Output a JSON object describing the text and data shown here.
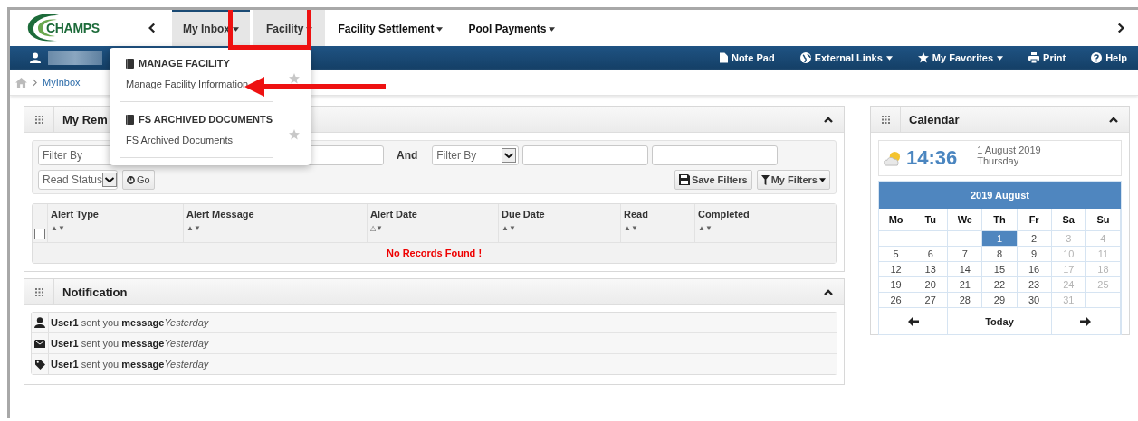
{
  "logo": {
    "text": "CHAMPS"
  },
  "nav": {
    "tabs": [
      {
        "label": "My Inbox",
        "selected": true,
        "expanded": false
      },
      {
        "label": "Facility",
        "selected": false,
        "expanded": true
      },
      {
        "label": "Facility Settlement",
        "selected": false,
        "expanded": false
      },
      {
        "label": "Pool Payments",
        "selected": false,
        "expanded": false
      }
    ]
  },
  "toolbar": {
    "links": [
      {
        "kind": "notepad",
        "label": "Note Pad",
        "caret": false
      },
      {
        "kind": "globe",
        "label": "External Links",
        "caret": true
      },
      {
        "kind": "star",
        "label": "My Favorites",
        "caret": true
      },
      {
        "kind": "print",
        "label": "Print",
        "caret": false
      },
      {
        "kind": "help",
        "label": "Help",
        "caret": false
      }
    ]
  },
  "breadcrumb": {
    "items": [
      "MyInbox"
    ]
  },
  "facility_menu": {
    "sections": [
      {
        "heading": "MANAGE FACILITY",
        "items": [
          {
            "label": "Manage Facility Information",
            "favorite": false
          }
        ]
      },
      {
        "heading": "FS ARCHIVED DOCUMENTS",
        "items": [
          {
            "label": "FS Archived Documents",
            "favorite": false
          }
        ]
      }
    ]
  },
  "reminders_panel": {
    "title": "My Rem",
    "filters": {
      "first_select": "Filter By",
      "and_label": "And",
      "second_select": "Filter By",
      "read_status": "Read Status",
      "go": "Go",
      "save_filters": "Save Filters",
      "my_filters": "My Filters"
    },
    "table": {
      "columns": [
        {
          "label": "Alert Type",
          "sort": "▲▼"
        },
        {
          "label": "Alert Message",
          "sort": "▲▼"
        },
        {
          "label": "Alert Date",
          "sort": "△▼"
        },
        {
          "label": "Due Date",
          "sort": "▲▼"
        },
        {
          "label": "Read",
          "sort": "▲▼"
        },
        {
          "label": "Completed",
          "sort": "▲▼"
        }
      ],
      "select_all_checked": false,
      "empty_message": "No Records Found !"
    }
  },
  "notification_panel": {
    "title": "Notification",
    "items": [
      {
        "kind": "user",
        "user": "User1",
        "text": "sent you",
        "subject": "message",
        "time": "Yesterday"
      },
      {
        "kind": "envelope",
        "user": "User1",
        "text": "sent you",
        "subject": "message",
        "time": "Yesterday"
      },
      {
        "kind": "tag",
        "user": "User1",
        "text": "sent you",
        "subject": "message",
        "time": "Yesterday"
      }
    ]
  },
  "calendar_panel": {
    "title": "Calendar",
    "time": "14:36",
    "date": "1 August 2019",
    "weekday": "Thursday",
    "month_title": "2019 August",
    "day_names": [
      "Mo",
      "Tu",
      "We",
      "Th",
      "Fr",
      "Sa",
      "Su"
    ],
    "weeks": [
      [
        {
          "kind": "blank"
        },
        {
          "kind": "blank"
        },
        {
          "kind": "blank"
        },
        {
          "kind": "day",
          "label": "1",
          "selected": true,
          "muted": false
        },
        {
          "kind": "day",
          "label": "2",
          "selected": false,
          "muted": false
        },
        {
          "kind": "day",
          "label": "3",
          "selected": false,
          "muted": true
        },
        {
          "kind": "day",
          "label": "4",
          "selected": false,
          "muted": true
        }
      ],
      [
        {
          "kind": "day",
          "label": "5",
          "selected": false,
          "muted": false
        },
        {
          "kind": "day",
          "label": "6",
          "selected": false,
          "muted": false
        },
        {
          "kind": "day",
          "label": "7",
          "selected": false,
          "muted": false
        },
        {
          "kind": "day",
          "label": "8",
          "selected": false,
          "muted": false
        },
        {
          "kind": "day",
          "label": "9",
          "selected": false,
          "muted": false
        },
        {
          "kind": "day",
          "label": "10",
          "selected": false,
          "muted": true
        },
        {
          "kind": "day",
          "label": "11",
          "selected": false,
          "muted": true
        }
      ],
      [
        {
          "kind": "day",
          "label": "12",
          "selected": false,
          "muted": false
        },
        {
          "kind": "day",
          "label": "13",
          "selected": false,
          "muted": false
        },
        {
          "kind": "day",
          "label": "14",
          "selected": false,
          "muted": false
        },
        {
          "kind": "day",
          "label": "15",
          "selected": false,
          "muted": false
        },
        {
          "kind": "day",
          "label": "16",
          "selected": false,
          "muted": false
        },
        {
          "kind": "day",
          "label": "17",
          "selected": false,
          "muted": true
        },
        {
          "kind": "day",
          "label": "18",
          "selected": false,
          "muted": true
        }
      ],
      [
        {
          "kind": "day",
          "label": "19",
          "selected": false,
          "muted": false
        },
        {
          "kind": "day",
          "label": "20",
          "selected": false,
          "muted": false
        },
        {
          "kind": "day",
          "label": "21",
          "selected": false,
          "muted": false
        },
        {
          "kind": "day",
          "label": "22",
          "selected": false,
          "muted": false
        },
        {
          "kind": "day",
          "label": "23",
          "selected": false,
          "muted": false
        },
        {
          "kind": "day",
          "label": "24",
          "selected": false,
          "muted": true
        },
        {
          "kind": "day",
          "label": "25",
          "selected": false,
          "muted": true
        }
      ],
      [
        {
          "kind": "day",
          "label": "26",
          "selected": false,
          "muted": false
        },
        {
          "kind": "day",
          "label": "27",
          "selected": false,
          "muted": false
        },
        {
          "kind": "day",
          "label": "28",
          "selected": false,
          "muted": false
        },
        {
          "kind": "day",
          "label": "29",
          "selected": false,
          "muted": false
        },
        {
          "kind": "day",
          "label": "30",
          "selected": false,
          "muted": false
        },
        {
          "kind": "day",
          "label": "31",
          "selected": false,
          "muted": true
        },
        {
          "kind": "blank"
        }
      ]
    ],
    "today": "Today"
  }
}
